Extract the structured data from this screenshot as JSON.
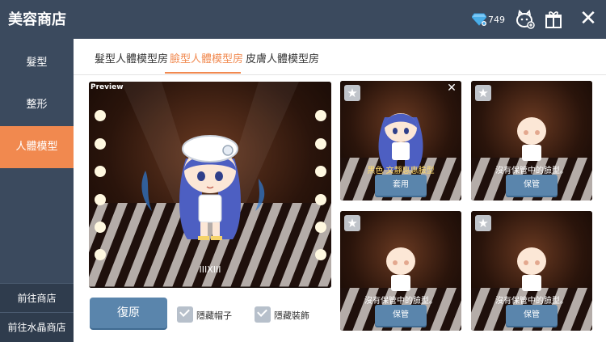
{
  "header": {
    "title": "美容商店",
    "gem_count": "749"
  },
  "sidebar": {
    "items": [
      "髮型",
      "整形",
      "人體模型"
    ],
    "active_index": 2,
    "bottom": [
      "前往商店",
      "前往水晶商店"
    ]
  },
  "tabs": {
    "items": [
      "髮型人體模型房",
      "臉型人體模型房",
      "皮膚人體模型房"
    ],
    "active_index": 1
  },
  "preview": {
    "label": "Preview",
    "character_name": "IIIXIII"
  },
  "actions": {
    "restore_label": "復原",
    "hide_hat_label": "隱藏帽子",
    "hide_gear_label": "隱藏裝飾"
  },
  "slots": [
    {
      "caption": "黑色 文靜惠惠臉型",
      "button": "套用",
      "filled": true
    },
    {
      "caption": "沒有保管中的臉型。",
      "button": "保管",
      "filled": false
    },
    {
      "caption": "沒有保管中的臉型。",
      "button": "保管",
      "filled": false
    },
    {
      "caption": "沒有保管中的臉型。",
      "button": "保管",
      "filled": false
    }
  ],
  "colors": {
    "header_bg": "#3b4a5e",
    "accent": "#f1894f",
    "button": "#5a85ac"
  }
}
